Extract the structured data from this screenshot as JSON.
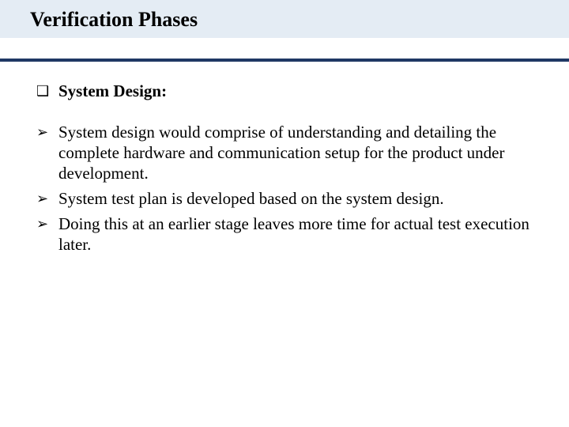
{
  "title": "Verification Phases",
  "section_heading": "System Design:",
  "bullets": [
    "System design would comprise of understanding and detailing the complete hardware and communication setup for the product under development.",
    "System test plan is developed based on the system design.",
    "Doing this at an earlier stage leaves more time for actual test execution later."
  ],
  "icons": {
    "square": "❑",
    "arrow": "➢"
  }
}
